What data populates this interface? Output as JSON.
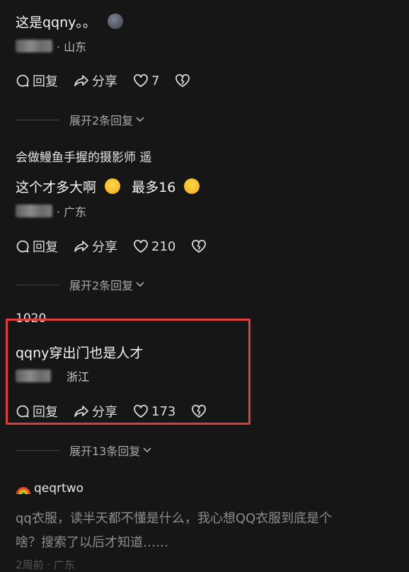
{
  "comments": [
    {
      "text": "这是qqny。。",
      "location": "· 山东",
      "reply_label": "回复",
      "share_label": "分享",
      "likes": "7",
      "expand_label": "展开2条回复"
    },
    {
      "username": "会做鳗鱼手握的摄影师 遥",
      "text": "这个才多大啊",
      "text2": "最多16",
      "location": "· 广东",
      "reply_label": "回复",
      "share_label": "分享",
      "likes": "210",
      "expand_label": "展开2条回复"
    },
    {
      "username": "1020",
      "text": "qqny穿出门也是人才",
      "location": "浙江",
      "reply_label": "回复",
      "share_label": "分享",
      "likes": "173",
      "expand_label": "展开13条回复"
    },
    {
      "username": "qeqrtwo",
      "text_line1": "qq衣服，读半天都不懂是什么，我心想QQ衣服到底是个",
      "text_line2": "啥？搜索了以后才知道……",
      "meta_partial": "2周前 · 广东"
    }
  ],
  "colors": {
    "background": "#161616",
    "highlight_box": "#e03c3c"
  }
}
